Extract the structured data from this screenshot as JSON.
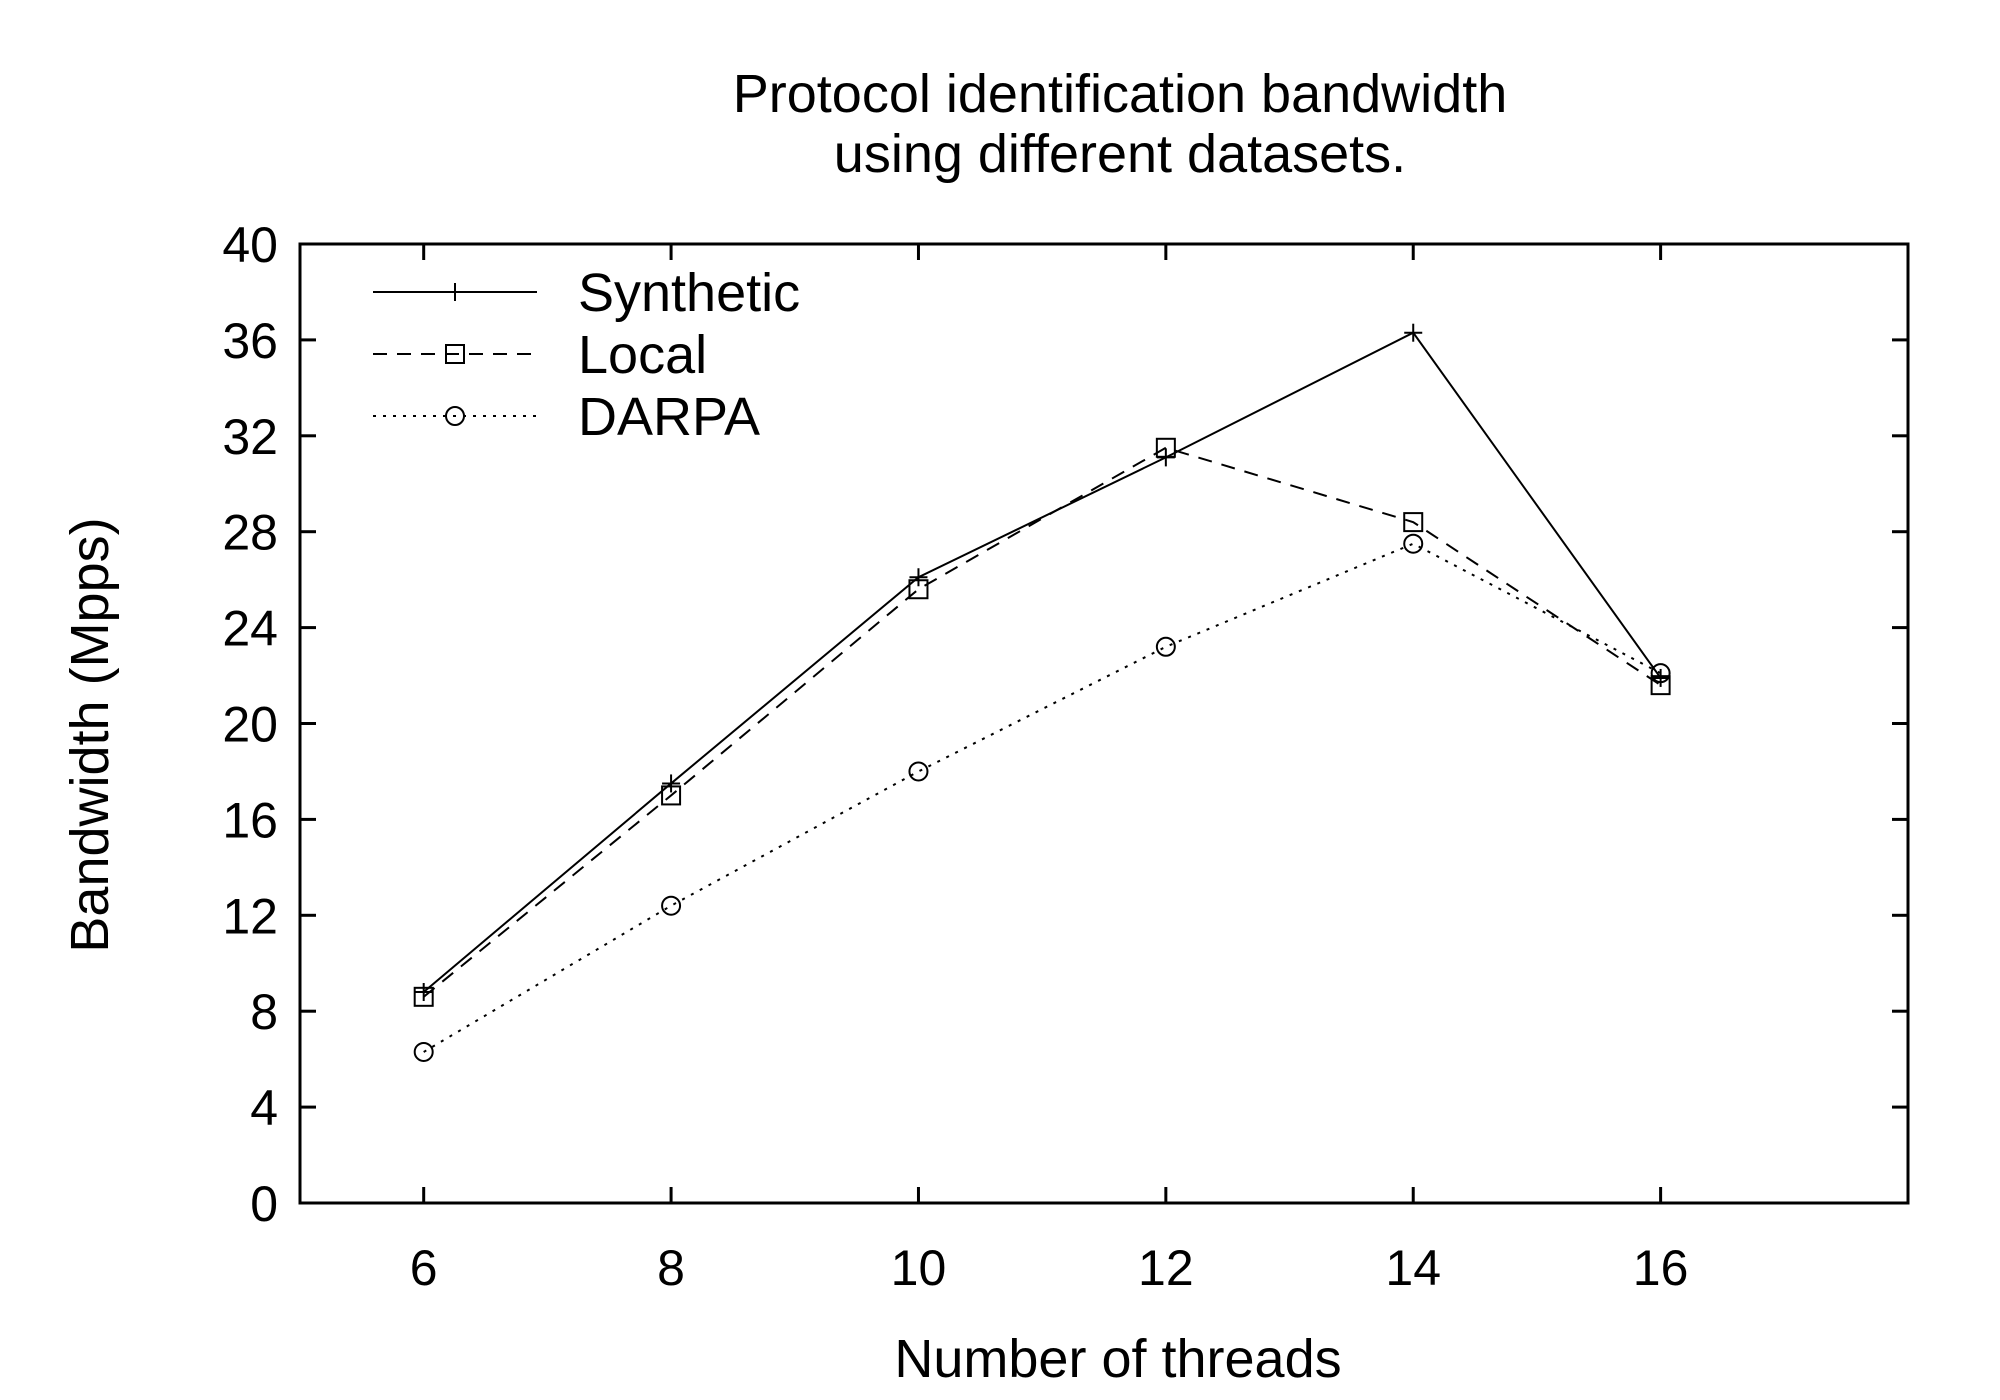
{
  "chart_data": {
    "type": "line",
    "title": [
      "Protocol identification bandwidth",
      "using different datasets."
    ],
    "xlabel": "Number of threads",
    "ylabel": "Bandwidth (Mpps)",
    "xlim": [
      5,
      18
    ],
    "ylim": [
      0,
      40
    ],
    "xticks": [
      6,
      8,
      10,
      12,
      14,
      16
    ],
    "yticks": [
      0,
      4,
      8,
      12,
      16,
      20,
      24,
      28,
      32,
      36,
      40
    ],
    "grid": false,
    "legend_position": "top-left",
    "x": [
      6,
      8,
      10,
      12,
      14,
      16
    ],
    "series": [
      {
        "name": "Synthetic",
        "marker": "plus",
        "dash": "solid",
        "values": [
          8.8,
          17.5,
          26.1,
          31.1,
          36.3,
          21.9
        ]
      },
      {
        "name": "Local",
        "marker": "square",
        "dash": "dashed",
        "values": [
          8.6,
          17.0,
          25.6,
          31.5,
          28.4,
          21.6
        ]
      },
      {
        "name": "DARPA",
        "marker": "circle",
        "dash": "dotted",
        "values": [
          6.3,
          12.4,
          18.0,
          23.2,
          27.5,
          22.1
        ]
      }
    ],
    "colors": {
      "line": "#000000",
      "background": "#ffffff"
    }
  }
}
